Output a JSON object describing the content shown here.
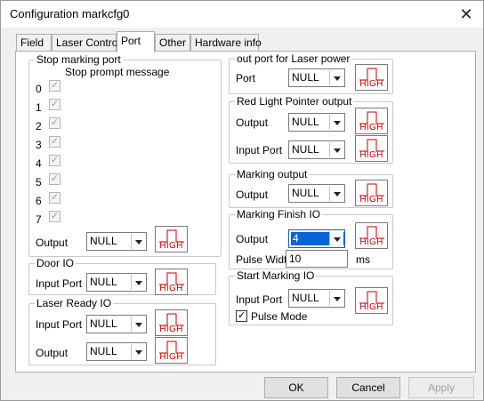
{
  "window": {
    "title": "Configuration markcfg0",
    "close_glyph": "✕"
  },
  "tabs": [
    "Field",
    "Laser Contro",
    "Port",
    "Other",
    "Hardware info"
  ],
  "active_tab": "Port",
  "stop_marking": {
    "title": "Stop marking port",
    "prompt_label": "Stop prompt message",
    "ports": [
      "0",
      "1",
      "2",
      "3",
      "4",
      "5",
      "6",
      "7"
    ],
    "output_label": "Output",
    "output_value": "NULL"
  },
  "door_io": {
    "title": "Door IO",
    "input_label": "Input Port",
    "input_value": "NULL"
  },
  "laser_ready": {
    "title": "Laser Ready IO",
    "input_label": "Input Port",
    "input_value": "NULL",
    "output_label": "Output",
    "output_value": "NULL"
  },
  "laser_power": {
    "title": "out port for Laser power",
    "port_label": "Port",
    "port_value": "NULL"
  },
  "red_light": {
    "title": "Red Light Pointer output",
    "output_label": "Output",
    "output_value": "NULL",
    "input_label": "Input Port",
    "input_value": "NULL"
  },
  "marking_output": {
    "title": "Marking output",
    "output_label": "Output",
    "output_value": "NULL"
  },
  "marking_finish": {
    "title": "Marking Finish IO",
    "output_label": "Output",
    "output_value": "4",
    "pulse_label": "Pulse Width",
    "pulse_value": "10",
    "pulse_unit": "ms"
  },
  "start_marking": {
    "title": "Start Marking IO",
    "input_label": "Input Port",
    "input_value": "NULL",
    "pulse_mode_label": "Pulse Mode",
    "pulse_mode_checked": true
  },
  "level_button_label": "HIGH",
  "colors": {
    "level_red": "#cc0000",
    "selection_blue": "#0a64d8"
  },
  "footer": {
    "ok": "OK",
    "cancel": "Cancel",
    "apply": "Apply"
  }
}
